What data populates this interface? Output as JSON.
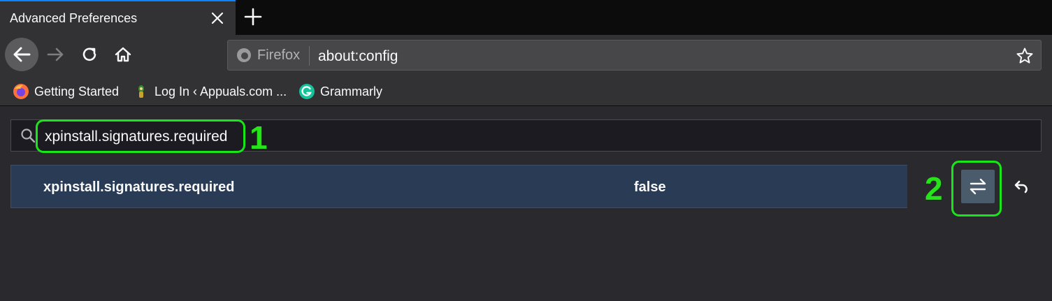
{
  "tab": {
    "title": "Advanced Preferences"
  },
  "urlbar": {
    "identity_label": "Firefox",
    "url": "about:config"
  },
  "bookmarks": [
    {
      "label": "Getting Started",
      "icon": "firefox-icon"
    },
    {
      "label": "Log In ‹ Appuals.com ...",
      "icon": "appuals-icon"
    },
    {
      "label": "Grammarly",
      "icon": "grammarly-icon"
    }
  ],
  "search": {
    "value": "xpinstall.signatures.required"
  },
  "pref": {
    "name": "xpinstall.signatures.required",
    "value": "false"
  },
  "annotations": {
    "step1": "1",
    "step2": "2"
  },
  "colors": {
    "accent": "#0a84ff",
    "highlight": "#19e619",
    "row_bg": "#2a3c55"
  }
}
